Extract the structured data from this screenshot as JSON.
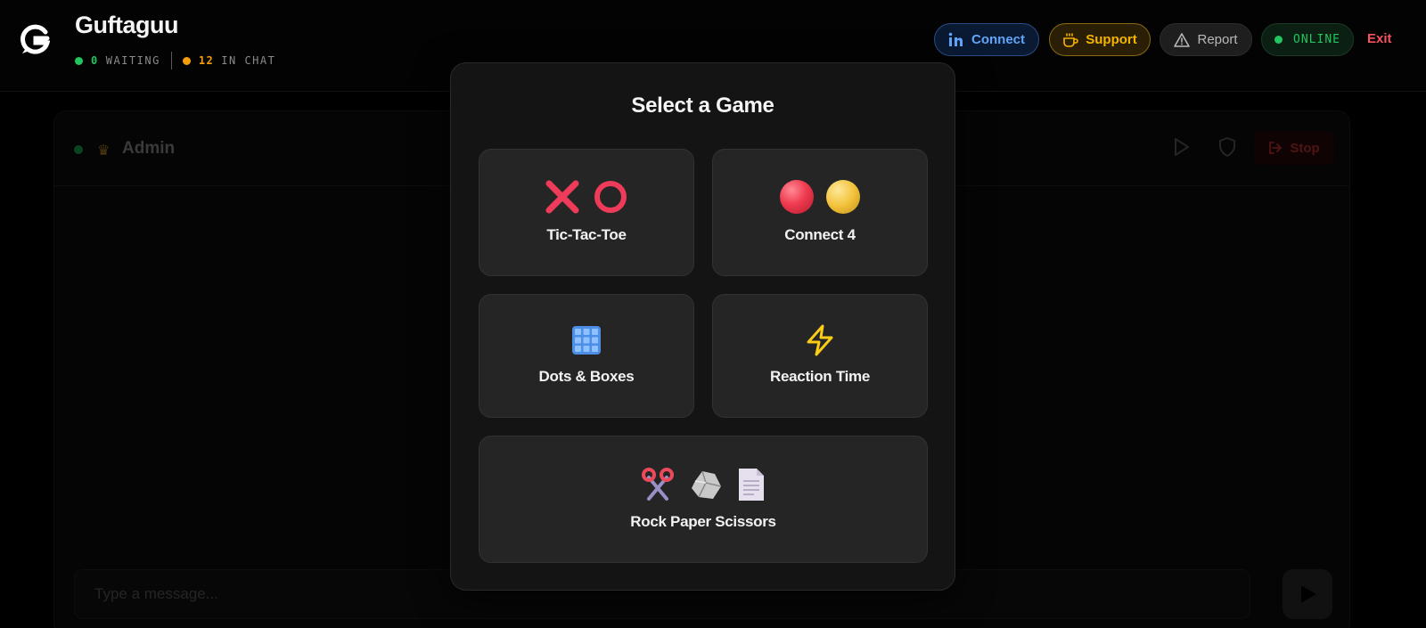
{
  "header": {
    "brand": "Guftaguu",
    "waiting_count": "0",
    "waiting_label": "WAITING",
    "chat_count": "12",
    "chat_label": "IN CHAT",
    "buttons": {
      "connect": "Connect",
      "support": "Support",
      "report": "Report",
      "online": "ONLINE",
      "exit": "Exit"
    }
  },
  "chat": {
    "partner_name": "Admin",
    "stop_label": "Stop",
    "message_placeholder": "Type a message..."
  },
  "modal": {
    "title": "Select a Game",
    "games": [
      {
        "name": "Tic-Tac-Toe",
        "icons": [
          "x-icon",
          "o-icon"
        ]
      },
      {
        "name": "Connect 4",
        "icons": [
          "red-disc-icon",
          "yellow-disc-icon"
        ]
      },
      {
        "name": "Dots & Boxes",
        "icons": [
          "grid-icon"
        ]
      },
      {
        "name": "Reaction Time",
        "icons": [
          "lightning-icon"
        ]
      },
      {
        "name": "Rock Paper Scissors",
        "icons": [
          "scissors-icon",
          "rock-icon",
          "paper-icon"
        ]
      }
    ]
  },
  "colors": {
    "accent_blue": "#60a5fa",
    "accent_gold": "#f5b400",
    "online_green": "#22c55e",
    "waiting_orange": "#f59e0b",
    "exit_red": "#f4525e",
    "tic_red": "#ef3b5a",
    "lightning_yellow": "#facc15"
  }
}
